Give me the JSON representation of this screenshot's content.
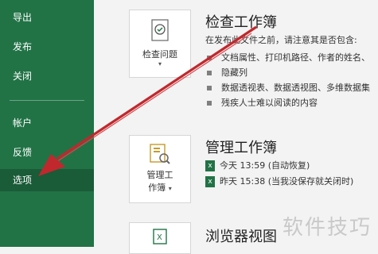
{
  "sidebar": {
    "items": [
      {
        "label": "导出"
      },
      {
        "label": "发布"
      },
      {
        "label": "关闭"
      },
      {
        "label": "帐户"
      },
      {
        "label": "反馈"
      },
      {
        "label": "选项"
      }
    ],
    "selected_index": 5
  },
  "inspect": {
    "button_label": "检查问题",
    "title": "检查工作簿",
    "intro": "在发布此文件之前，请注意其是否包含:",
    "bullets": [
      "文档属性、打印机路径、作者的姓名、",
      "隐藏列",
      "数据透视表、数据透视图、多维数据集",
      "残疾人士难以阅读的内容"
    ]
  },
  "manage": {
    "button_label_1": "管理工",
    "button_label_2": "作簿",
    "title": "管理工作簿",
    "versions": [
      {
        "text": "今天 13:59 (自动恢复)"
      },
      {
        "text": "昨天 15:38 (当我没保存就关闭时)"
      }
    ]
  },
  "browser": {
    "title": "浏览器视图"
  },
  "watermark": "软件技巧",
  "colors": {
    "sidebar": "#217346",
    "arrow": "#c0282d"
  }
}
